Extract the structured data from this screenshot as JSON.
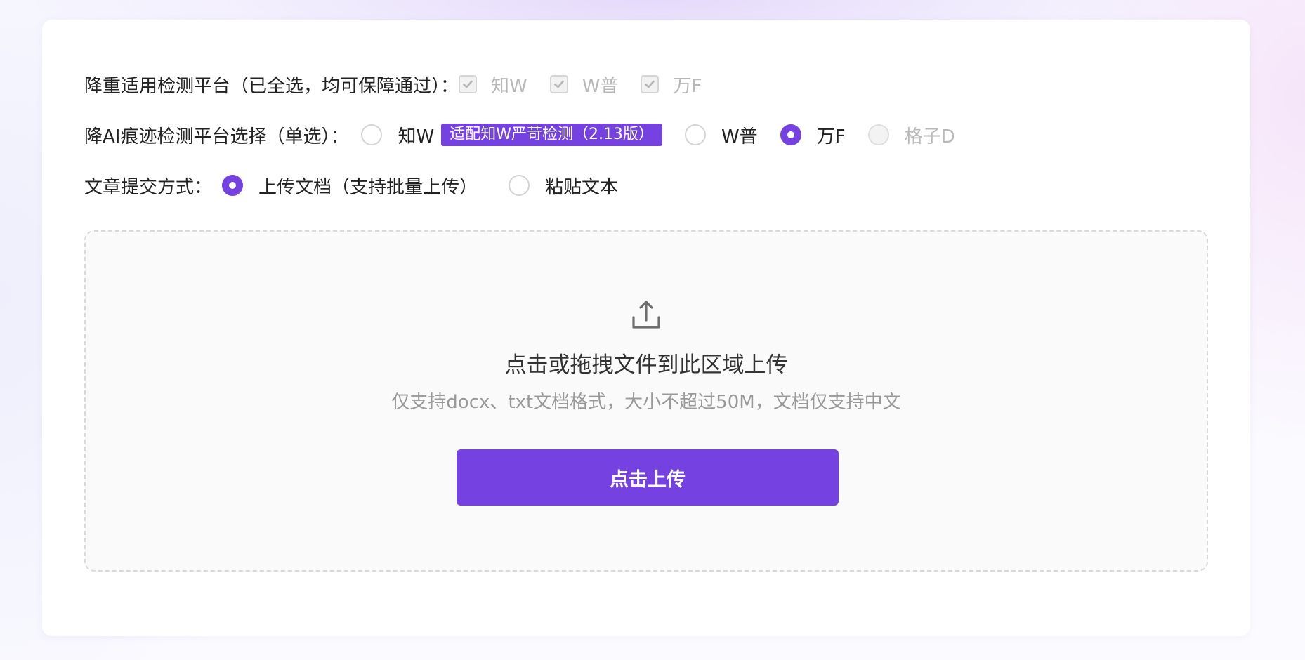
{
  "colors": {
    "accent": "#7541e0",
    "disabled_text": "#b8b8b8",
    "muted_text": "#999999"
  },
  "dedup_platforms": {
    "label": "降重适用检测平台（已全选，均可保障通过）：",
    "options": [
      {
        "label": "知W",
        "checked": true,
        "disabled": true
      },
      {
        "label": "W普",
        "checked": true,
        "disabled": true
      },
      {
        "label": "万F",
        "checked": true,
        "disabled": true
      }
    ]
  },
  "ai_platforms": {
    "label": "降AI痕迹检测平台选择（单选）：",
    "options": [
      {
        "label": "知W",
        "selected": false,
        "badge": "适配知W严苛检测（2.13版）"
      },
      {
        "label": "W普",
        "selected": false
      },
      {
        "label": "万F",
        "selected": true
      },
      {
        "label": "格子D",
        "selected": false,
        "disabled": true
      }
    ]
  },
  "submit_method": {
    "label": "文章提交方式：",
    "options": [
      {
        "label": "上传文档（支持批量上传）",
        "selected": true
      },
      {
        "label": "粘贴文本",
        "selected": false
      }
    ]
  },
  "upload": {
    "icon": "upload-icon",
    "title": "点击或拖拽文件到此区域上传",
    "hint": "仅支持docx、txt文档格式，大小不超过50M，文档仅支持中文",
    "button_label": "点击上传"
  }
}
